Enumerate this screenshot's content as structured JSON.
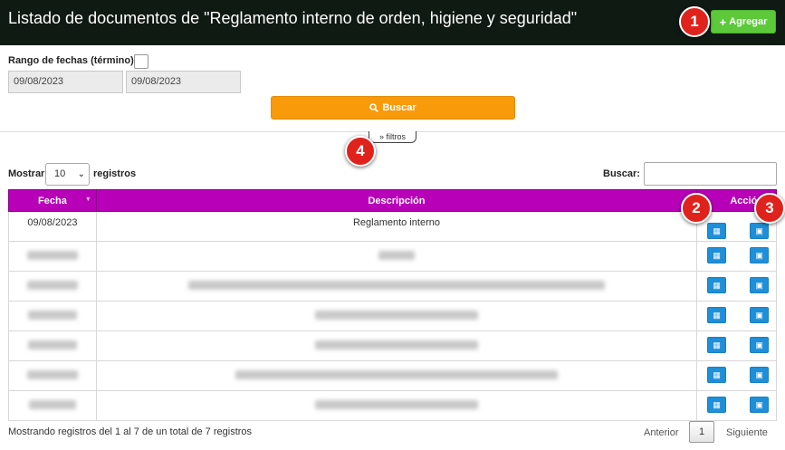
{
  "header": {
    "title": "Listado de documentos de \"Reglamento interno de orden, higiene y seguridad\"",
    "add_label": "Agregar",
    "add_icon": "plus-icon"
  },
  "markers": [
    "1",
    "2",
    "3",
    "4"
  ],
  "filters": {
    "range_label": "Rango de fechas (término):",
    "date_from": "09/08/2023",
    "date_to": "09/08/2023",
    "search_label": "Buscar",
    "search_icon": "search-icon",
    "toggle_label": "filtros",
    "toggle_icon": "chevron-up-icon"
  },
  "table_controls": {
    "show_label": "Mostrar",
    "page_size": "10",
    "records_label": "registros",
    "search_label": "Buscar:"
  },
  "table": {
    "columns": [
      "Fecha",
      "Descripción",
      "Acción"
    ],
    "rows": [
      {
        "fecha": "09/08/2023",
        "descripcion": "Reglamento interno"
      }
    ],
    "blurred_rows": 6
  },
  "footer": {
    "info": "Mostrando registros del 1 al 7 de un total de 7 registros",
    "prev": "Anterior",
    "page": "1",
    "next": "Siguiente"
  },
  "colors": {
    "header_bg": "#0f1a13",
    "add_button": "#5cc93a",
    "search_button": "#f99a0b",
    "table_header": "#b800b8",
    "action_button": "#1e8fd9",
    "marker": "#e0221d"
  }
}
